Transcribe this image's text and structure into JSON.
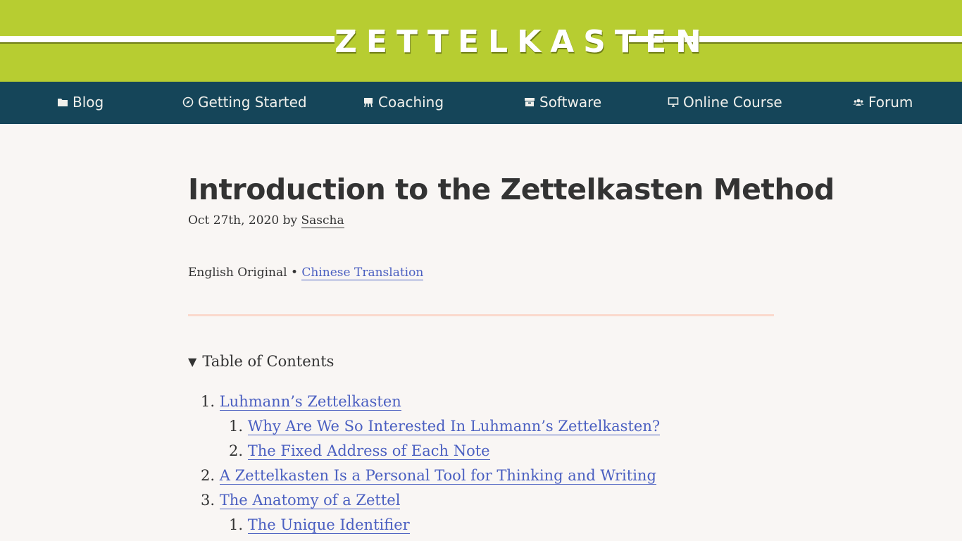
{
  "header": {
    "site_title": "ZETTELKASTEN",
    "banner_color": "#b7cd31"
  },
  "nav": {
    "background_color": "#154559",
    "items": [
      {
        "label": "Blog",
        "icon": "folder-icon"
      },
      {
        "label": "Getting Started",
        "icon": "compass-icon"
      },
      {
        "label": "Coaching",
        "icon": "easel-icon"
      },
      {
        "label": "Software",
        "icon": "archive-box-icon"
      },
      {
        "label": "Online Course",
        "icon": "monitor-icon"
      },
      {
        "label": "Forum",
        "icon": "users-icon"
      }
    ]
  },
  "article": {
    "title": "Introduction to the Zettelkasten Method",
    "date": "Oct 27th, 2020",
    "by_word": "by",
    "author": "Sascha",
    "language_original": "English Original",
    "language_separator": "•",
    "translation_link": "Chinese Translation"
  },
  "toc": {
    "toggle_icon": "triangle-down-icon",
    "summary": "Table of Contents",
    "items": [
      {
        "number": "1.",
        "label": "Luhmann’s Zettelkasten"
      },
      {
        "number": "1.",
        "label": "Why Are We So Interested In Luhmann’s Zettelkasten?"
      },
      {
        "number": "2.",
        "label": "The Fixed Address of Each Note"
      },
      {
        "number": "2.",
        "label": "A Zettelkasten Is a Personal Tool for Thinking and Writing"
      },
      {
        "number": "3.",
        "label": "The Anatomy of a Zettel"
      },
      {
        "number": "1.",
        "label": "The Unique Identifier"
      }
    ]
  },
  "colors": {
    "link": "#4a5fc1",
    "divider": "#fbd9cd",
    "page_background": "#f9f6f4",
    "text": "#333333"
  }
}
